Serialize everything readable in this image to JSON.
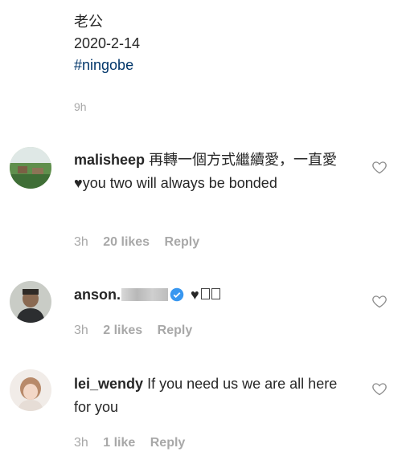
{
  "post": {
    "caption_line1": "老公",
    "caption_line2": "2020-2-14",
    "hashtag": "#ningobe",
    "time": "9h"
  },
  "comments": [
    {
      "username": "malisheep",
      "text": "再轉一個方式繼續愛，一直愛",
      "text_after_heart": "you two will always be bonded",
      "time": "3h",
      "likes": "20 likes",
      "reply": "Reply"
    },
    {
      "username": "anson.",
      "verified": true,
      "time": "3h",
      "likes": "2 likes",
      "reply": "Reply"
    },
    {
      "username": "lei_wendy",
      "text": "If you need us we are all here for you",
      "time": "3h",
      "likes": "1 like",
      "reply": "Reply"
    }
  ],
  "colors": {
    "text": "#262626",
    "muted": "#a8a8a8",
    "hashtag": "#003569",
    "verified": "#3897f0"
  },
  "icons": [
    "heart-outline-icon",
    "heart-icon",
    "verified-badge-icon"
  ]
}
